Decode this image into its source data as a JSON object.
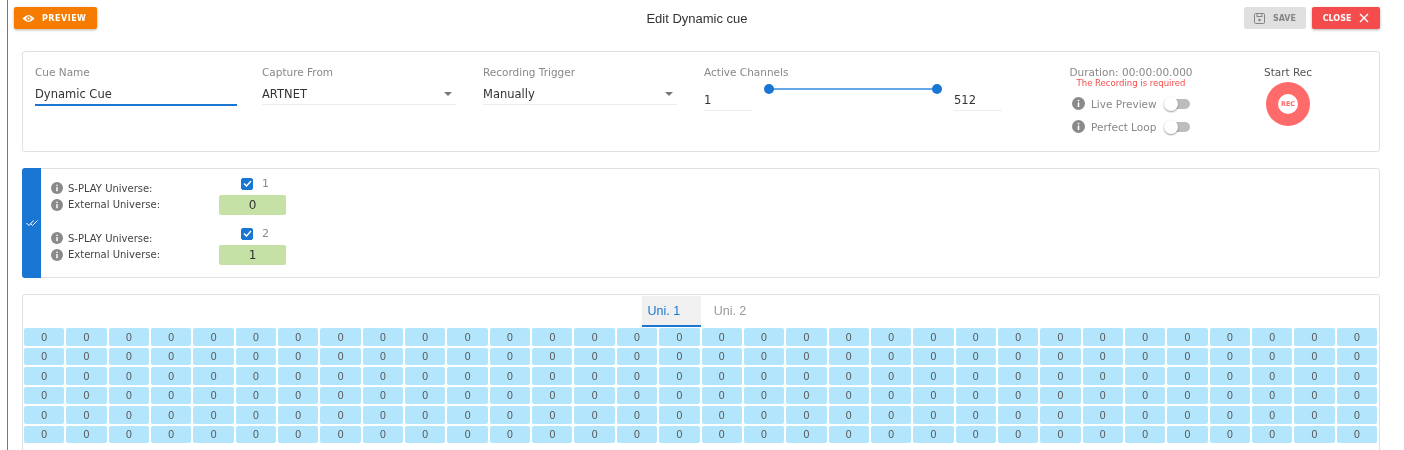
{
  "header": {
    "preview_label": "PREVIEW",
    "title": "Edit Dynamic cue",
    "save": {
      "label": "SAVE",
      "disabled": true
    },
    "close_label": "CLOSE"
  },
  "settings": {
    "cue_name": {
      "label": "Cue Name",
      "value": "Dynamic Cue"
    },
    "capture_from": {
      "label": "Capture From",
      "value": "ARTNET"
    },
    "recording_trigger": {
      "label": "Recording Trigger",
      "value": "Manually"
    },
    "active_channels": {
      "label": "Active Channels",
      "min": "1",
      "max": "512",
      "thumbs": [
        {
          "level": 0
        },
        {
          "level": 1
        }
      ]
    },
    "duration": "Duration: 00:00:00.000",
    "error": "The Recording is required",
    "toggles": [
      {
        "label": "Live Preview",
        "on": false
      },
      {
        "label": "Perfect Loop",
        "on": false
      }
    ],
    "start_rec": {
      "label": "Start Rec",
      "button": "REC"
    }
  },
  "universes": [
    {
      "splay_label": "S-PLAY Universe:",
      "checked": true,
      "number": "1",
      "external_label": "External Universe:",
      "external_value": "0"
    },
    {
      "splay_label": "S-PLAY Universe:",
      "checked": true,
      "number": "2",
      "external_label": "External Universe:",
      "external_value": "1"
    }
  ],
  "tabs": [
    {
      "label": "Uni. 1",
      "selected": true
    },
    {
      "label": "Uni. 2",
      "selected": false
    }
  ],
  "channel_rows": [
    [
      "0",
      "0",
      "0",
      "0",
      "0",
      "0",
      "0",
      "0",
      "0",
      "0",
      "0",
      "0",
      "0",
      "0",
      "0",
      "0",
      "0",
      "0",
      "0",
      "0",
      "0",
      "0",
      "0",
      "0",
      "0",
      "0",
      "0",
      "0",
      "0",
      "0",
      "0",
      "0"
    ],
    [
      "0",
      "0",
      "0",
      "0",
      "0",
      "0",
      "0",
      "0",
      "0",
      "0",
      "0",
      "0",
      "0",
      "0",
      "0",
      "0",
      "0",
      "0",
      "0",
      "0",
      "0",
      "0",
      "0",
      "0",
      "0",
      "0",
      "0",
      "0",
      "0",
      "0",
      "0",
      "0"
    ],
    [
      "0",
      "0",
      "0",
      "0",
      "0",
      "0",
      "0",
      "0",
      "0",
      "0",
      "0",
      "0",
      "0",
      "0",
      "0",
      "0",
      "0",
      "0",
      "0",
      "0",
      "0",
      "0",
      "0",
      "0",
      "0",
      "0",
      "0",
      "0",
      "0",
      "0",
      "0",
      "0"
    ],
    [
      "0",
      "0",
      "0",
      "0",
      "0",
      "0",
      "0",
      "0",
      "0",
      "0",
      "0",
      "0",
      "0",
      "0",
      "0",
      "0",
      "0",
      "0",
      "0",
      "0",
      "0",
      "0",
      "0",
      "0",
      "0",
      "0",
      "0",
      "0",
      "0",
      "0",
      "0",
      "0"
    ],
    [
      "0",
      "0",
      "0",
      "0",
      "0",
      "0",
      "0",
      "0",
      "0",
      "0",
      "0",
      "0",
      "0",
      "0",
      "0",
      "0",
      "0",
      "0",
      "0",
      "0",
      "0",
      "0",
      "0",
      "0",
      "0",
      "0",
      "0",
      "0",
      "0",
      "0",
      "0",
      "0"
    ],
    [
      "0",
      "0",
      "0",
      "0",
      "0",
      "0",
      "0",
      "0",
      "0",
      "0",
      "0",
      "0",
      "0",
      "0",
      "0",
      "0",
      "0",
      "0",
      "0",
      "0",
      "0",
      "0",
      "0",
      "0",
      "0",
      "0",
      "0",
      "0",
      "0",
      "0",
      "0",
      "0"
    ]
  ]
}
